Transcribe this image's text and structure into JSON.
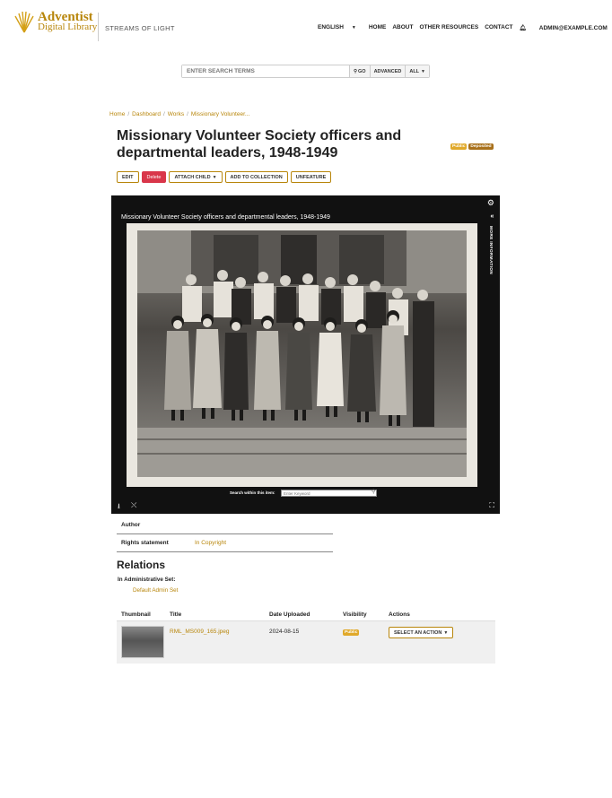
{
  "brand": {
    "logo_line1": "Adventist",
    "logo_line2": "Digital Library",
    "tagline": "STREAMS OF LIGHT",
    "accent_color": "#b8860b"
  },
  "nav": {
    "language": "ENGLISH",
    "home": "HOME",
    "about": "ABOUT",
    "other_resources": "OTHER RESOURCES",
    "contact": "CONTACT",
    "user": "ADMIN@EXAMPLE.COM"
  },
  "search": {
    "placeholder": "ENTER SEARCH TERMS",
    "go": "GO",
    "advanced": "ADVANCED",
    "scope": "ALL"
  },
  "breadcrumb": [
    "Home",
    "Dashboard",
    "Works",
    "Missionary Volunteer..."
  ],
  "work": {
    "title": "Missionary Volunteer Society officers and departmental leaders, 1948-1949",
    "badges": [
      "Public",
      "Deposited"
    ]
  },
  "actions": {
    "edit": "EDIT",
    "delete": "Delete",
    "attach_child": "ATTACH CHILD",
    "add_to_collection": "ADD TO COLLECTION",
    "unfeature": "UNFEATURE"
  },
  "viewer": {
    "title": "Missionary Volunteer Society officers and departmental leaders, 1948-1949",
    "more_information": "MORE INFORMATION",
    "search_label": "Search within this item:",
    "search_placeholder": "Enter Keyword",
    "icons": [
      "gear-icon",
      "download-icon",
      "share-icon",
      "fullscreen-icon"
    ]
  },
  "metadata": [
    {
      "key": "Author",
      "value": ""
    },
    {
      "key": "Rights statement",
      "value": "In Copyright"
    }
  ],
  "relations": {
    "title": "Relations",
    "admin_set_label": "In Administrative Set:",
    "admin_set_value": "Default Admin Set"
  },
  "files": {
    "headers": [
      "Thumbnail",
      "Title",
      "Date Uploaded",
      "Visibility",
      "Actions"
    ],
    "rows": [
      {
        "title": "RML_MS009_165.jpeg",
        "date": "2024-08-15",
        "visibility": "Public",
        "action": "SELECT AN ACTION"
      }
    ]
  }
}
